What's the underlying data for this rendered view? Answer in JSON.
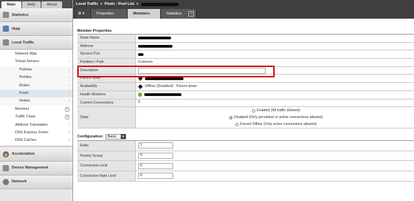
{
  "top_tabs": [
    {
      "label": "Main"
    },
    {
      "label": "Help"
    },
    {
      "label": "About"
    }
  ],
  "sidebar": {
    "statistics": "Statistics",
    "iapp": "iApp",
    "local_traffic": "Local Traffic",
    "items": [
      {
        "label": "Network Map"
      },
      {
        "label": "Virtual Servers"
      },
      {
        "label": "Policies"
      },
      {
        "label": "Profiles"
      },
      {
        "label": "iRules"
      },
      {
        "label": "Pools"
      },
      {
        "label": "Nodes"
      },
      {
        "label": "Monitors"
      },
      {
        "label": "Traffic Class"
      },
      {
        "label": "Address Translation"
      },
      {
        "label": "DNS Express Zones"
      },
      {
        "label": "DNS Caches"
      }
    ],
    "acceleration": "Acceleration",
    "device_management": "Device Management",
    "network": "Network"
  },
  "header": {
    "breadcrumb": [
      "Local Traffic",
      "Pools : Pool List"
    ],
    "tabs": [
      {
        "label": "Properties"
      },
      {
        "label": "Members"
      },
      {
        "label": "Statistics"
      }
    ]
  },
  "member_properties": {
    "title": "Member Properties",
    "labels": {
      "node_name": "Node Name",
      "address": "Address",
      "service_port": "Service Port",
      "partition": "Partition / Path",
      "description": "Description",
      "parent_node": "Parent Node",
      "availability": "Availability",
      "health_monitors": "Health Monitors",
      "current_connections": "Current Connections",
      "state": "State"
    },
    "values": {
      "partition": "Common",
      "availability": "Offline (Disabled) - Parent down",
      "current_connections": "0"
    },
    "state_options": [
      {
        "label": "Enabled (All traffic allowed)"
      },
      {
        "label": "Disabled (Only persistent or active connections allowed)"
      },
      {
        "label": "Forced Offline (Only active connections allowed)"
      }
    ]
  },
  "configuration": {
    "label": "Configuration:",
    "mode": "Basic",
    "rows": [
      {
        "label": "Ratio",
        "value": "1"
      },
      {
        "label": "Priority Group",
        "value": "0"
      },
      {
        "label": "Connection Limit",
        "value": "0"
      },
      {
        "label": "Connection Rate Limit",
        "value": "0"
      }
    ]
  },
  "colors": {
    "highlight": "#d80000",
    "header_bg": "#3f3f3f",
    "status_green": "#6cae3c"
  }
}
